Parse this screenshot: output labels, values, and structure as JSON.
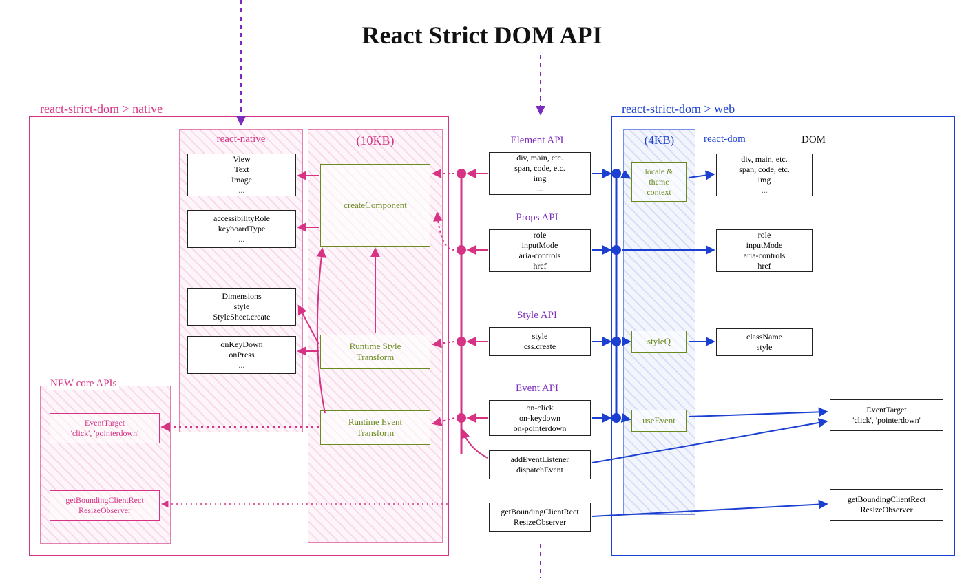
{
  "title": "React Strict DOM API",
  "native": {
    "label": "react-strict-dom > native",
    "newCoreLabel": "NEW core APIs",
    "newCore": {
      "eventTarget": "EventTarget\n'click', 'pointerdown'",
      "gbcr": "getBoundingClientRect\nResizeObserver"
    },
    "rnLabel": "react-native",
    "rnBox1": "View\nText\nImage\n...",
    "rnBox2": "accessibilityRole\nkeyboardType\n...",
    "rnBox3": "Dimensions\nstyle\nStyleSheet.create",
    "rnBox4": "onKeyDown\nonPress\n...",
    "tenkbLabel": "(10KB)",
    "createComponent": "createComponent",
    "runtimeStyle": "Runtime Style\nTransform",
    "runtimeEvent": "Runtime Event\nTransform"
  },
  "middle": {
    "elementLabel": "Element API",
    "elementBox": "div, main, etc.\nspan, code, etc.\nimg\n...",
    "propsLabel": "Props API",
    "propsBox": "role\ninputMode\naria-controls\nhref",
    "styleLabel": "Style API",
    "styleBox": "style\ncss.create",
    "eventLabel": "Event API",
    "eventBox": "on-click\non-keydown\non-pointerdown",
    "addEventBox": "addEventListener\ndispatchEvent",
    "gbcrBox": "getBoundingClientRect\nResizeObserver"
  },
  "web": {
    "label": "react-strict-dom > web",
    "fourkbLabel": "(4KB)",
    "localeTheme": "locale &\ntheme\ncontext",
    "styleQ": "styleQ",
    "useEvent": "useEvent",
    "reactDomLabel": "react-dom",
    "domLabel": "DOM",
    "domBox1": "div, main, etc.\nspan, code, etc.\nimg\n...",
    "domBox2": "role\ninputMode\naria-controls\nhref",
    "domBox3": "className\nstyle",
    "domBox4": "EventTarget\n'click', 'pointerdown'",
    "domBox5": "getBoundingClientRect\nResizeObserver"
  }
}
